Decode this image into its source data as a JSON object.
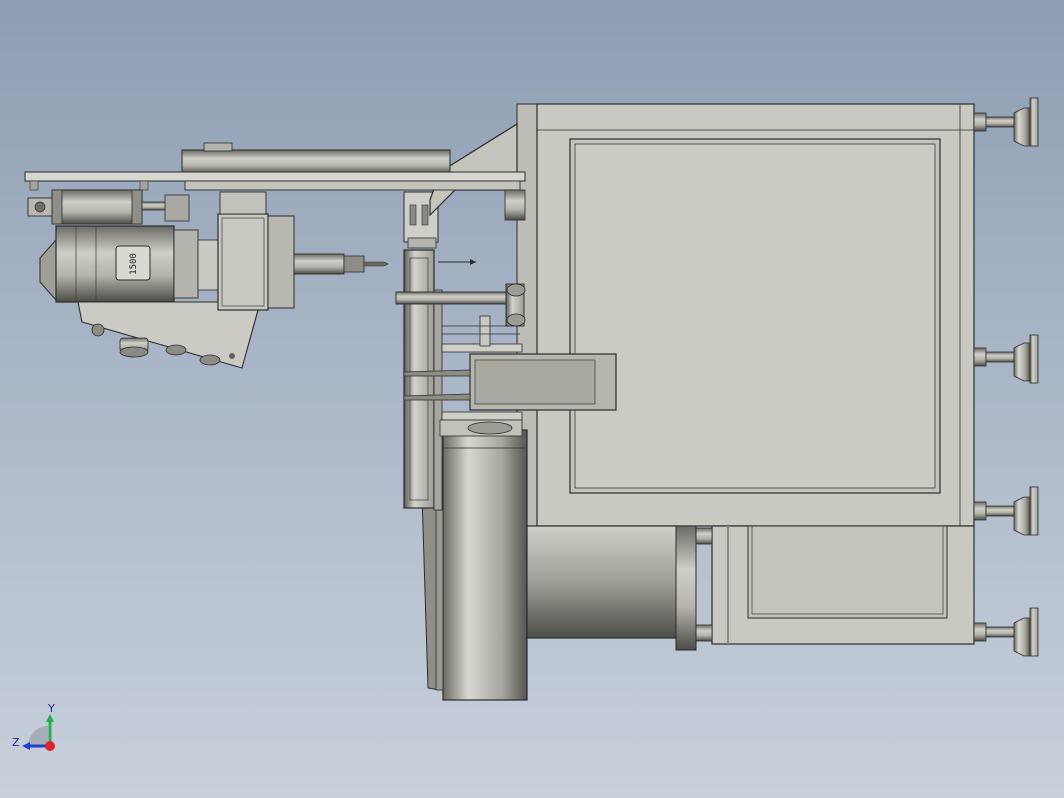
{
  "view": {
    "background_top": "#8e9db2",
    "background_bottom": "#c8d0db",
    "part_fill": "#c9c9c2",
    "edge_color": "#2b2b2b"
  },
  "motor_label": "1500",
  "triad": {
    "y_label": "Y",
    "z_label": "Z",
    "y_color": "#22b14c",
    "z_color": "#1f3fcf",
    "origin_color": "#e0202a"
  }
}
